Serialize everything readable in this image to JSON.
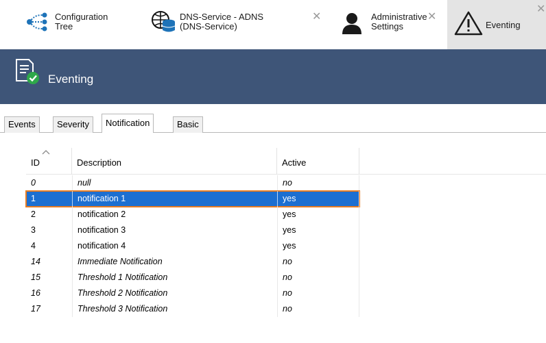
{
  "doc_tabs": [
    {
      "label": "Configuration\nTree",
      "closable": false,
      "icon": "configuration-tree-icon"
    },
    {
      "label": "DNS-Service - ADNS\n(DNS-Service)",
      "closable": true,
      "icon": "dns-service-icon"
    },
    {
      "label": "Administrative\nSettings",
      "closable": true,
      "icon": "user-icon"
    },
    {
      "label": "Eventing",
      "closable": true,
      "active": true,
      "icon": "warning-icon"
    }
  ],
  "close_glyph": "✕",
  "header": {
    "title": "Eventing",
    "icon": "eventing-document-check-icon"
  },
  "tabs": [
    "Events",
    "Severity",
    "Notification",
    "Basic"
  ],
  "selected_tab": "Notification",
  "table": {
    "columns": [
      "ID",
      "Description",
      "Active"
    ],
    "sort_indicator": "ascending",
    "rows": [
      {
        "id": "0",
        "description": "null",
        "active": "no",
        "italic": true
      },
      {
        "id": "1",
        "description": "notification 1",
        "active": "yes",
        "italic": false,
        "selected": true
      },
      {
        "id": "2",
        "description": "notification 2",
        "active": "yes",
        "italic": false
      },
      {
        "id": "3",
        "description": "notification 3",
        "active": "yes",
        "italic": false
      },
      {
        "id": "4",
        "description": "notification 4",
        "active": "yes",
        "italic": false
      },
      {
        "id": "14",
        "description": "Immediate Notification",
        "active": "no",
        "italic": true
      },
      {
        "id": "15",
        "description": "Threshold 1 Notification",
        "active": "no",
        "italic": true
      },
      {
        "id": "16",
        "description": "Threshold 2 Notification",
        "active": "no",
        "italic": true
      },
      {
        "id": "17",
        "description": "Threshold 3 Notification",
        "active": "no",
        "italic": true
      }
    ]
  },
  "colors": {
    "header_bg": "#3e5578",
    "selection_bg": "#1c6fd1",
    "selection_border": "#e87c21",
    "active_doc_tab_bg": "#e4e4e4"
  }
}
